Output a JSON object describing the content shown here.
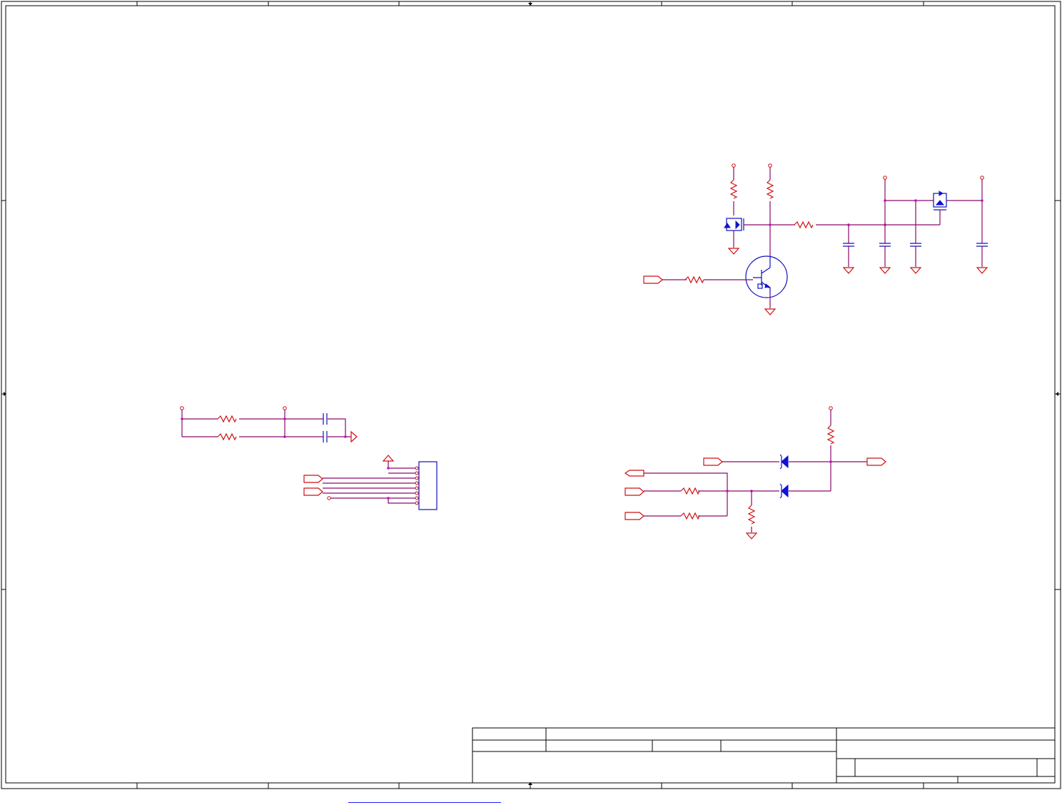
{
  "sheet": {
    "border_color": "#000000",
    "wire_color": "#8a0a6a",
    "power_color": "#d01010",
    "component_color": "#1010c0"
  },
  "title_block": {
    "fields": []
  },
  "icons": {
    "resistor": "resistor-icon",
    "capacitor": "capacitor-icon",
    "transistor": "npn-transistor-icon",
    "mosfet": "mosfet-icon",
    "diode": "diode-icon",
    "ground": "ground-icon",
    "power": "power-pin-icon",
    "connector": "connector-header-icon",
    "port": "net-port-icon"
  }
}
